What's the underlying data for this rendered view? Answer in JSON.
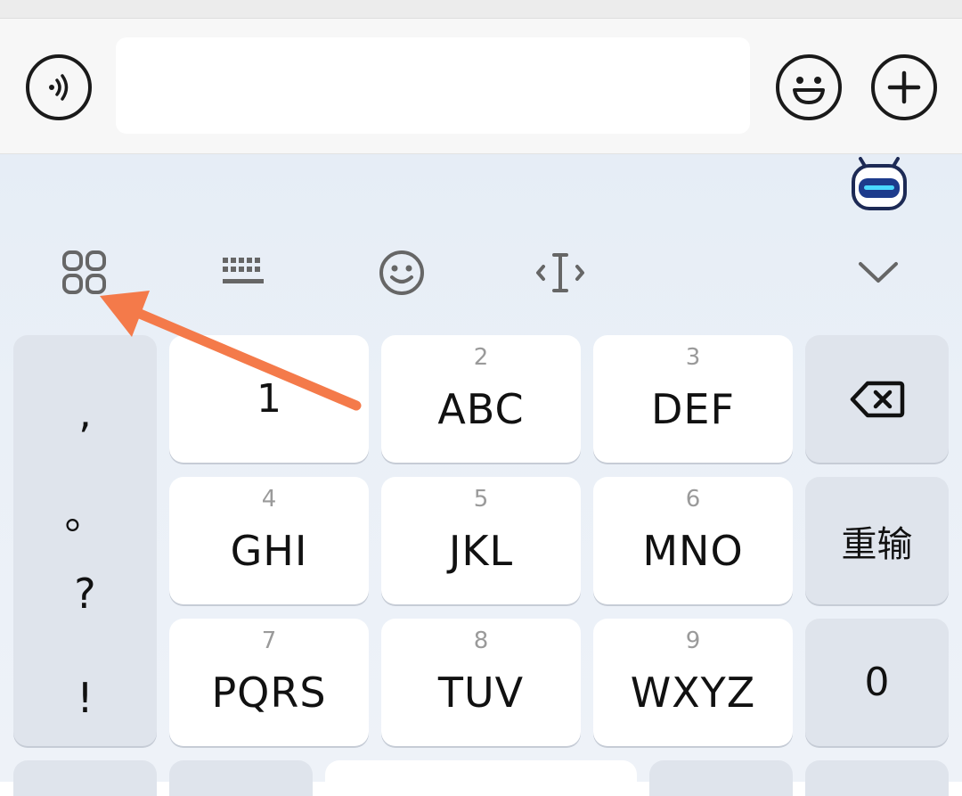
{
  "input_bar": {
    "voice_button": "voice-icon",
    "text_field_value": "",
    "emoji_button": "emoji-icon",
    "plus_button": "plus-icon"
  },
  "toolbar": {
    "items": [
      "apps-grid-icon",
      "keyboard-icon",
      "emoji-icon",
      "cursor-icon",
      "collapse-chevron-icon"
    ]
  },
  "punctuation": [
    ",",
    "。",
    "?",
    "!"
  ],
  "keys": {
    "k1": {
      "label": "1"
    },
    "k2": {
      "num": "2",
      "label": "ABC"
    },
    "k3": {
      "num": "3",
      "label": "DEF"
    },
    "k4": {
      "num": "4",
      "label": "GHI"
    },
    "k5": {
      "num": "5",
      "label": "JKL"
    },
    "k6": {
      "num": "6",
      "label": "MNO"
    },
    "k7": {
      "num": "7",
      "label": "PQRS"
    },
    "k8": {
      "num": "8",
      "label": "TUV"
    },
    "k9": {
      "num": "9",
      "label": "WXYZ"
    },
    "k0": {
      "label": "0"
    },
    "retype": {
      "label": "重输"
    }
  },
  "colors": {
    "annotation_arrow": "#f47a4a",
    "keyboard_bg": "#e9eff7",
    "function_key": "#dfe4ec"
  }
}
